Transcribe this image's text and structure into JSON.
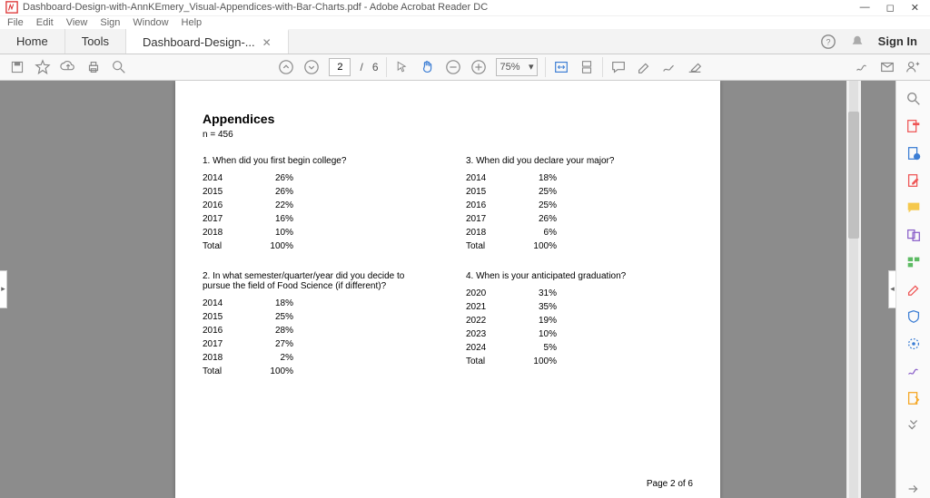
{
  "titlebar": {
    "filename": "Dashboard-Design-with-AnnKEmery_Visual-Appendices-with-Bar-Charts.pdf - Adobe Acrobat Reader DC"
  },
  "menubar": [
    "File",
    "Edit",
    "View",
    "Sign",
    "Window",
    "Help"
  ],
  "tabs": {
    "home": "Home",
    "tools": "Tools",
    "doc": "Dashboard-Design-..."
  },
  "tabs_right": {
    "signin": "Sign In"
  },
  "toolbar": {
    "page_current": "2",
    "page_sep": "/",
    "page_total": "6",
    "zoom": "75%"
  },
  "doc": {
    "heading": "Appendices",
    "nline": "n = 456",
    "q1": {
      "title": "1. When did you first begin college?",
      "rows": [
        {
          "y": "2014",
          "v": "26%"
        },
        {
          "y": "2015",
          "v": "26%"
        },
        {
          "y": "2016",
          "v": "22%"
        },
        {
          "y": "2017",
          "v": "16%"
        },
        {
          "y": "2018",
          "v": "10%"
        },
        {
          "y": "Total",
          "v": "100%"
        }
      ]
    },
    "q2": {
      "title": "2. In what semester/quarter/year did you decide to pursue the field of Food Science (if different)?",
      "rows": [
        {
          "y": "2014",
          "v": "18%"
        },
        {
          "y": "2015",
          "v": "25%"
        },
        {
          "y": "2016",
          "v": "28%"
        },
        {
          "y": "2017",
          "v": "27%"
        },
        {
          "y": "2018",
          "v": "2%"
        },
        {
          "y": "Total",
          "v": "100%"
        }
      ]
    },
    "q3": {
      "title": "3. When did you declare your major?",
      "rows": [
        {
          "y": "2014",
          "v": "18%"
        },
        {
          "y": "2015",
          "v": "25%"
        },
        {
          "y": "2016",
          "v": "25%"
        },
        {
          "y": "2017",
          "v": "26%"
        },
        {
          "y": "2018",
          "v": "6%"
        },
        {
          "y": "Total",
          "v": "100%"
        }
      ]
    },
    "q4": {
      "title": "4. When is your anticipated graduation?",
      "rows": [
        {
          "y": "2020",
          "v": "31%"
        },
        {
          "y": "2021",
          "v": "35%"
        },
        {
          "y": "2022",
          "v": "19%"
        },
        {
          "y": "2023",
          "v": "10%"
        },
        {
          "y": "2024",
          "v": "5%"
        },
        {
          "y": "Total",
          "v": "100%"
        }
      ]
    },
    "footer": "Page 2 of 6"
  },
  "chart_data": [
    {
      "type": "table",
      "title": "1. When did you first begin college?",
      "categories": [
        "2014",
        "2015",
        "2016",
        "2017",
        "2018"
      ],
      "values": [
        26,
        26,
        22,
        16,
        10
      ],
      "ylabel": "%"
    },
    {
      "type": "table",
      "title": "2. In what semester/quarter/year did you decide to pursue the field of Food Science (if different)?",
      "categories": [
        "2014",
        "2015",
        "2016",
        "2017",
        "2018"
      ],
      "values": [
        18,
        25,
        28,
        27,
        2
      ],
      "ylabel": "%"
    },
    {
      "type": "table",
      "title": "3. When did you declare your major?",
      "categories": [
        "2014",
        "2015",
        "2016",
        "2017",
        "2018"
      ],
      "values": [
        18,
        25,
        25,
        26,
        6
      ],
      "ylabel": "%"
    },
    {
      "type": "table",
      "title": "4. When is your anticipated graduation?",
      "categories": [
        "2020",
        "2021",
        "2022",
        "2023",
        "2024"
      ],
      "values": [
        31,
        35,
        19,
        10,
        5
      ],
      "ylabel": "%"
    }
  ]
}
